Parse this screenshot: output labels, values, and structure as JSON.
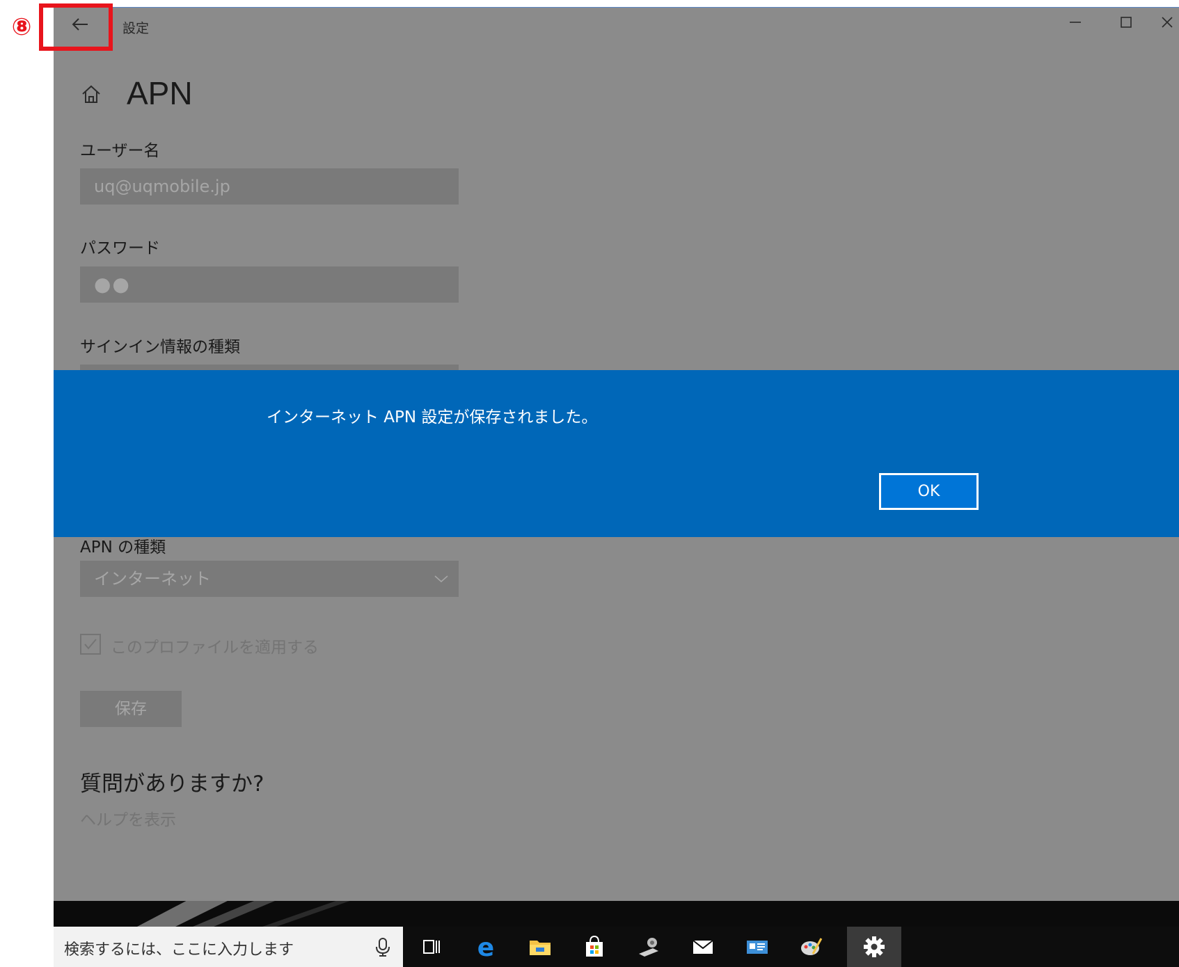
{
  "annotation": {
    "marker": "⑧"
  },
  "window": {
    "title": "設定"
  },
  "page": {
    "title": "APN"
  },
  "fields": {
    "username": {
      "label": "ユーザー名",
      "value": "uq@uqmobile.jp"
    },
    "password": {
      "label": "パスワード",
      "value": "●●"
    },
    "signin_type": {
      "label": "サインイン情報の種類"
    },
    "apn_type": {
      "label": "APN の種類",
      "value": "インターネット"
    }
  },
  "apply_profile": {
    "label": "このプロファイルを適用する",
    "checked": true
  },
  "save_button": {
    "label": "保存"
  },
  "help": {
    "title": "質問がありますか?",
    "link": "ヘルプを表示"
  },
  "dialog": {
    "message": "インターネット APN 設定が保存されました。",
    "ok_label": "OK"
  },
  "taskbar": {
    "search_placeholder": "検索するには、ここに入力します"
  },
  "colors": {
    "overlay_bg": "#8b8b8b",
    "dialog_bg": "#0067b8",
    "annotation_red": "#e8141c"
  }
}
